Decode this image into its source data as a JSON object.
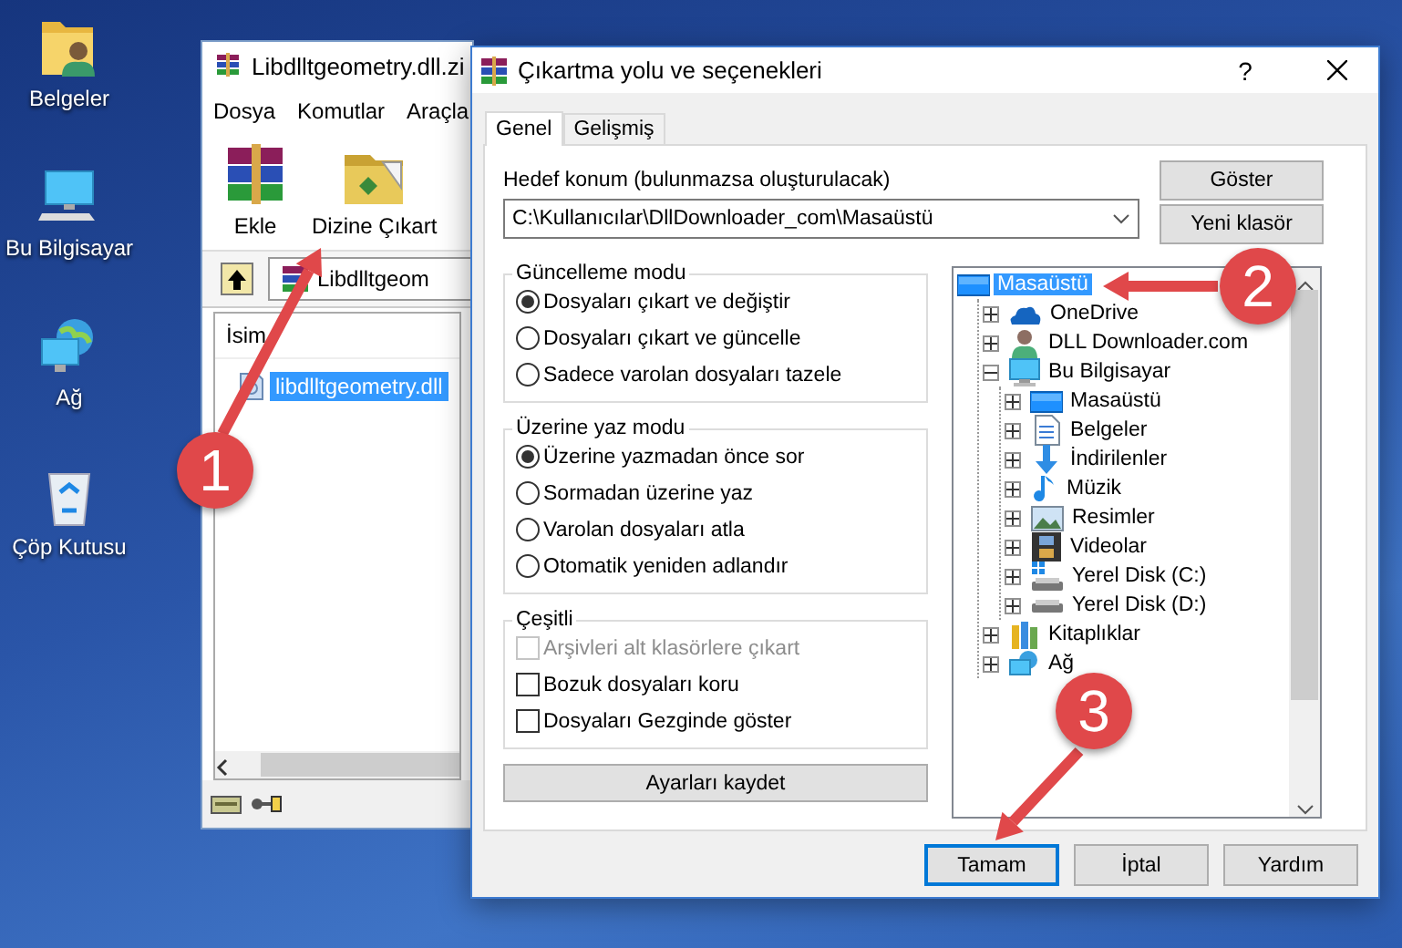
{
  "desktop_icons": [
    {
      "label": "Belgeler",
      "kind": "documents"
    },
    {
      "label": "Bu Bilgisayar",
      "kind": "computer"
    },
    {
      "label": "Ağ",
      "kind": "network"
    },
    {
      "label": "Çöp Kutusu",
      "kind": "recycle"
    }
  ],
  "archiver_window": {
    "title": "Libdlltgeometry.dll.zi",
    "menu": [
      "Dosya",
      "Komutlar",
      "Araçla"
    ],
    "toolbar": [
      {
        "label": "Ekle",
        "kind": "add"
      },
      {
        "label": "Dizine Çıkart",
        "kind": "extract"
      }
    ],
    "path": "Libdlltgeom",
    "columns": [
      "İsim"
    ],
    "files": [
      {
        "name": "libdlltgeometry.dll",
        "selected": true
      }
    ]
  },
  "dialog": {
    "title": "Çıkartma yolu ve seçenekleri",
    "help": "?",
    "tabs": [
      {
        "label": "Genel",
        "selected": true
      },
      {
        "label": "Gelişmiş",
        "selected": false
      }
    ],
    "destination_label": "Hedef konum (bulunmazsa oluşturulacak)",
    "destination": "C:\\Kullanıcılar\\DllDownloader_com\\Masaüstü",
    "side_buttons": [
      "Göster",
      "Yeni klasör"
    ],
    "groups": [
      {
        "title": "Güncelleme modu",
        "options": [
          {
            "kind": "radio",
            "label": "Dosyaları çıkart ve değiştir",
            "checked": true,
            "disabled": false
          },
          {
            "kind": "radio",
            "label": "Dosyaları çıkart ve güncelle",
            "checked": false,
            "disabled": false
          },
          {
            "kind": "radio",
            "label": "Sadece varolan dosyaları tazele",
            "checked": false,
            "disabled": false
          }
        ]
      },
      {
        "title": "Üzerine yaz modu",
        "options": [
          {
            "kind": "radio",
            "label": "Üzerine yazmadan önce sor",
            "checked": true,
            "disabled": false
          },
          {
            "kind": "radio",
            "label": "Sormadan üzerine yaz",
            "checked": false,
            "disabled": false
          },
          {
            "kind": "radio",
            "label": "Varolan dosyaları atla",
            "checked": false,
            "disabled": false
          },
          {
            "kind": "radio",
            "label": "Otomatik yeniden adlandır",
            "checked": false,
            "disabled": false
          }
        ]
      },
      {
        "title": "Çeşitli",
        "options": [
          {
            "kind": "checkbox",
            "label": "Arşivleri alt klasörlere çıkart",
            "checked": false,
            "disabled": true
          },
          {
            "kind": "checkbox",
            "label": "Bozuk dosyaları koru",
            "checked": false,
            "disabled": false
          },
          {
            "kind": "checkbox",
            "label": "Dosyaları Gezginde göster",
            "checked": false,
            "disabled": false
          }
        ]
      }
    ],
    "save_button": "Ayarları kaydet",
    "tree": [
      {
        "label": "Masaüstü",
        "kind": "desktop",
        "selected": true,
        "children": [
          {
            "label": "OneDrive",
            "kind": "cloud",
            "selected": false,
            "expanded": false
          },
          {
            "label": "DLL Downloader.com",
            "kind": "user",
            "selected": false,
            "expanded": false
          },
          {
            "label": "Bu Bilgisayar",
            "kind": "computer",
            "selected": false,
            "expanded": true,
            "children": [
              {
                "label": "Masaüstü",
                "kind": "desktop",
                "selected": false,
                "expanded": false
              },
              {
                "label": "Belgeler",
                "kind": "document",
                "selected": false,
                "expanded": false
              },
              {
                "label": "İndirilenler",
                "kind": "download",
                "selected": false,
                "expanded": false
              },
              {
                "label": "Müzik",
                "kind": "music",
                "selected": false,
                "expanded": false
              },
              {
                "label": "Resimler",
                "kind": "image",
                "selected": false,
                "expanded": false
              },
              {
                "label": "Videolar",
                "kind": "film",
                "selected": false,
                "expanded": false
              },
              {
                "label": "Yerel Disk (C:)",
                "kind": "system-drive",
                "selected": false,
                "expanded": false
              },
              {
                "label": "Yerel Disk (D:)",
                "kind": "drive",
                "selected": false,
                "expanded": false
              }
            ]
          },
          {
            "label": "Kitaplıklar",
            "kind": "library",
            "selected": false,
            "expanded": false
          },
          {
            "label": "Ağ",
            "kind": "network",
            "selected": false,
            "expanded": false
          }
        ]
      }
    ],
    "buttons": [
      {
        "label": "Tamam",
        "default": true
      },
      {
        "label": "İptal",
        "default": false
      },
      {
        "label": "Yardım",
        "default": false
      }
    ]
  },
  "callouts": [
    {
      "number": "1"
    },
    {
      "number": "2"
    },
    {
      "number": "3"
    }
  ]
}
